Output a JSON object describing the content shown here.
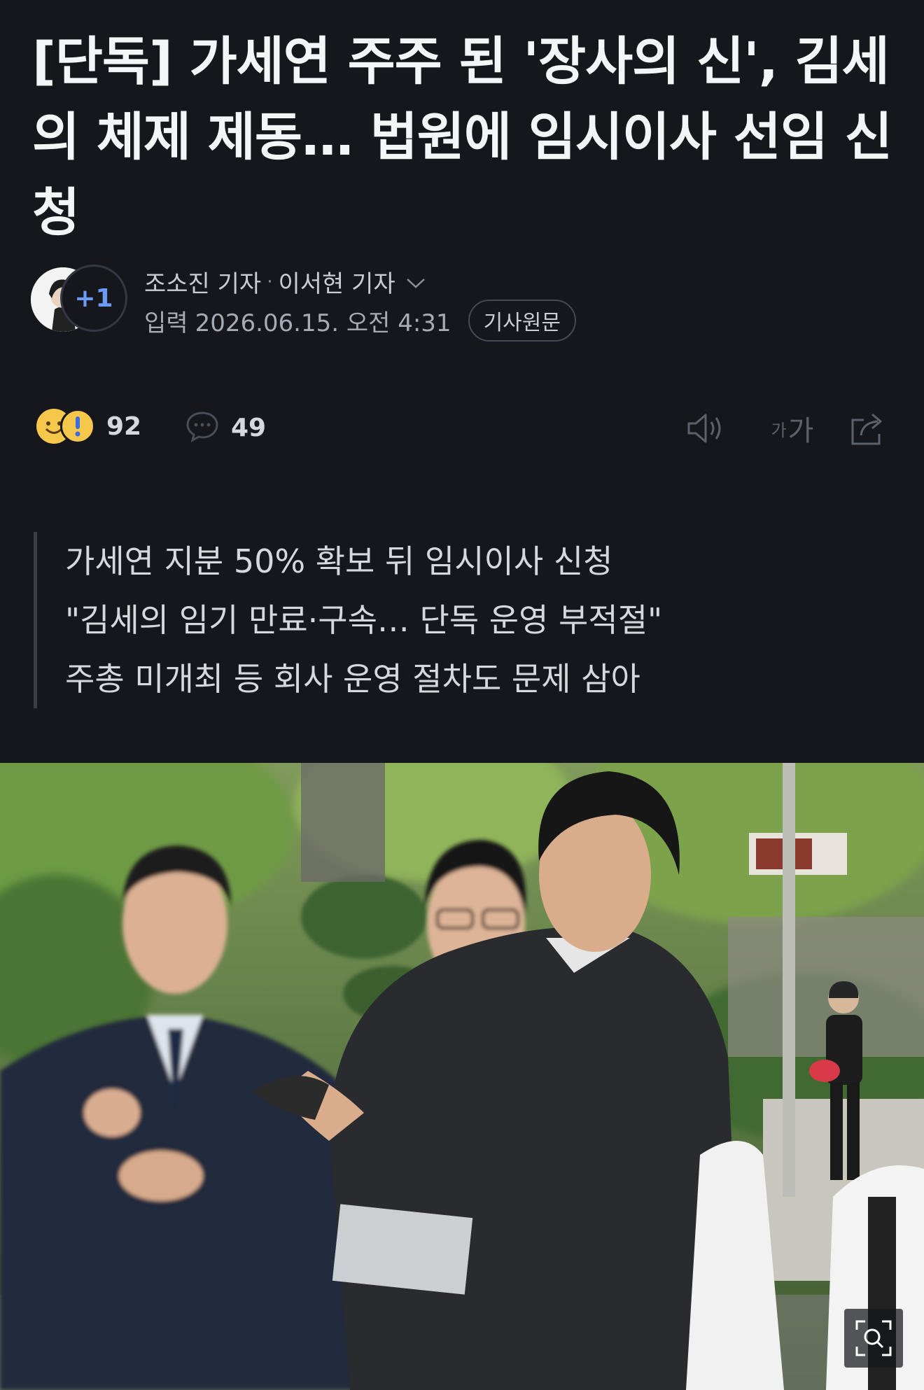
{
  "article": {
    "headline": "[단독] 가세연 주주 된 '장사의 신', 김세의 체제 제동… 법원에 임시이사 선임 신청",
    "reporters": {
      "first": "조소진 기자",
      "separator": "·",
      "second": "이서현 기자",
      "extra_count": "+1"
    },
    "date_label": "입력",
    "date_value": "2026.06.15. 오전 4:31",
    "original_button": "기사원문"
  },
  "stats": {
    "reaction_count": "92",
    "comment_count": "49",
    "font_size_label_small": "가",
    "font_size_label_large": "가"
  },
  "summary": {
    "lines": [
      "가세연 지분 50% 확보 뒤 임시이사 신청",
      "\"김세의 임기 만료·구속… 단독 운영 부적절\"",
      "주총 미개최 등 회사 운영 절차도 문제 삼아"
    ]
  },
  "icons": {
    "reaction_1": "smile-emoji-icon",
    "reaction_2": "surprised-emoji-icon",
    "comment": "comment-bubble-icon",
    "speaker": "speaker-icon",
    "font_size": "font-size-icon",
    "share": "share-icon",
    "zoom": "zoom-search-icon",
    "dropdown": "chevron-down-icon"
  },
  "colors": {
    "background": "#15171c",
    "accent": "#6d9af8"
  }
}
